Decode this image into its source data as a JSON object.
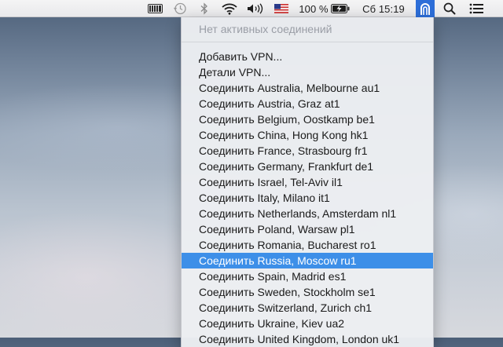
{
  "menubar": {
    "battery_percent": "100 %",
    "clock": "Сб 15:19",
    "icons": [
      "battery-status-icon",
      "time-machine-icon",
      "bluetooth-icon",
      "wifi-icon",
      "volume-icon",
      "us-flag-input-icon",
      "battery-icon",
      "vpn-icon",
      "spotlight-search-icon",
      "notification-center-icon"
    ]
  },
  "vpn_menu": {
    "header": "Нет активных соединений",
    "items": [
      "Добавить VPN...",
      "Детали VPN...",
      "Соединить Australia, Melbourne au1",
      "Соединить Austria, Graz at1",
      "Соединить Belgium, Oostkamp be1",
      "Соединить China, Hong Kong hk1",
      "Соединить France, Strasbourg fr1",
      "Соединить Germany, Frankfurt de1",
      "Соединить Israel, Tel-Aviv il1",
      "Соединить Italy, Milano it1",
      "Соединить Netherlands, Amsterdam nl1",
      "Соединить Poland, Warsaw pl1",
      "Соединить Romania, Bucharest ro1",
      "Соединить Russia, Moscow ru1",
      "Соединить Spain, Madrid es1",
      "Соединить Sweden, Stockholm se1",
      "Соединить Switzerland, Zurich ch1",
      "Соединить Ukraine, Kiev ua2",
      "Соединить United Kingdom, London uk1"
    ],
    "selected_index": 13
  },
  "colors": {
    "selection": "#3d8fe8",
    "vpn_active": "#2d6ed8"
  }
}
